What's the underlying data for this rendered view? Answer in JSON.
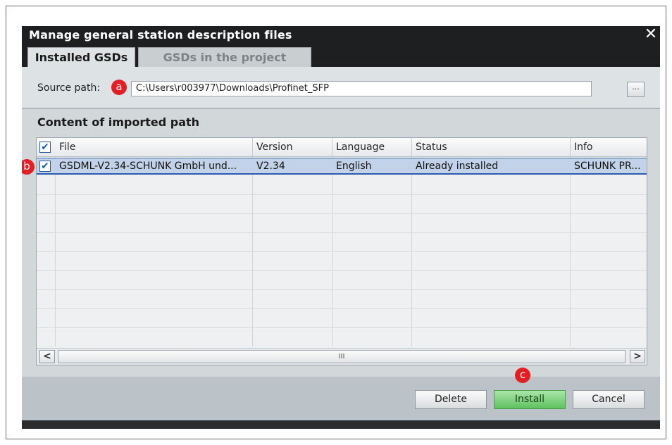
{
  "dialog": {
    "title": "Manage general station description files",
    "close_glyph": "✕"
  },
  "tabs": [
    {
      "label": "Installed GSDs",
      "active": true
    },
    {
      "label": "GSDs in the project",
      "active": false
    }
  ],
  "source": {
    "label": "Source path:",
    "value": "C:\\Users\\r003977\\Downloads\\Profinet_SFP",
    "browse_label": "..."
  },
  "content": {
    "heading": "Content of imported path"
  },
  "table": {
    "columns": [
      "File",
      "Version",
      "Language",
      "Status",
      "Info"
    ],
    "header_checked": true,
    "rows": [
      {
        "checked": true,
        "file": "GSDML-V2.34-SCHUNK GmbH und...",
        "version": "V2.34",
        "language": "English",
        "status": "Already installed",
        "info": "SCHUNK PR..."
      }
    ]
  },
  "scrollbar": {
    "left_arrow": "<",
    "right_arrow": ">",
    "grip": "III"
  },
  "buttons": {
    "delete": "Delete",
    "install": "Install",
    "cancel": "Cancel"
  },
  "callouts": {
    "a": "a",
    "b": "b",
    "c": "c"
  },
  "colors": {
    "title_bar": "#1d1f21",
    "callout": "#e31e24",
    "selection": "#c2d2e8",
    "install_button": "#5fc15f"
  }
}
